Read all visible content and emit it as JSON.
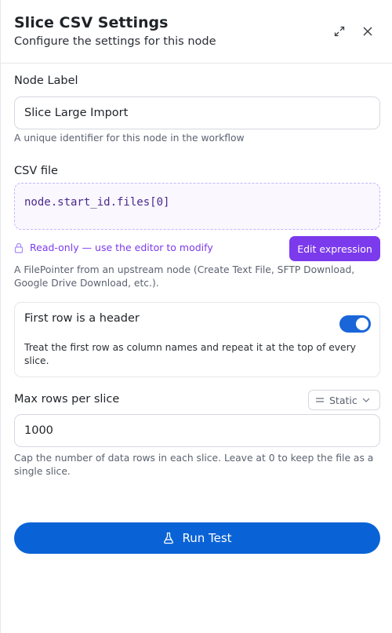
{
  "header": {
    "title": "Slice CSV Settings",
    "subtitle": "Configure the settings for this node",
    "expand_icon": "expand-icon",
    "close_icon": "close-icon"
  },
  "node_label": {
    "label": "Node Label",
    "value": "Slice Large Import",
    "help": "A unique identifier for this node in the workflow"
  },
  "csv_file": {
    "label": "CSV file",
    "expression": "node.start_id.files[0]",
    "readonly_text": "Read-only — use the editor to modify",
    "edit_button": "Edit expression",
    "help": "A FilePointer from an upstream node (Create Text File, SFTP Download, Google Drive Download, etc.)."
  },
  "header_row": {
    "title": "First row is a header",
    "description": "Treat the first row as column names and repeat it at the top of every slice.",
    "enabled": true
  },
  "max_rows": {
    "label": "Max rows per slice",
    "mode": "Static",
    "value": "1000",
    "help": "Cap the number of data rows in each slice. Leave at 0 to keep the file as a single slice."
  },
  "run_button": {
    "label": "Run Test",
    "icon": "flask-icon"
  },
  "colors": {
    "accent": "#7c3aed",
    "primary": "#0a63d6",
    "toggle_on": "#1a66d9"
  }
}
